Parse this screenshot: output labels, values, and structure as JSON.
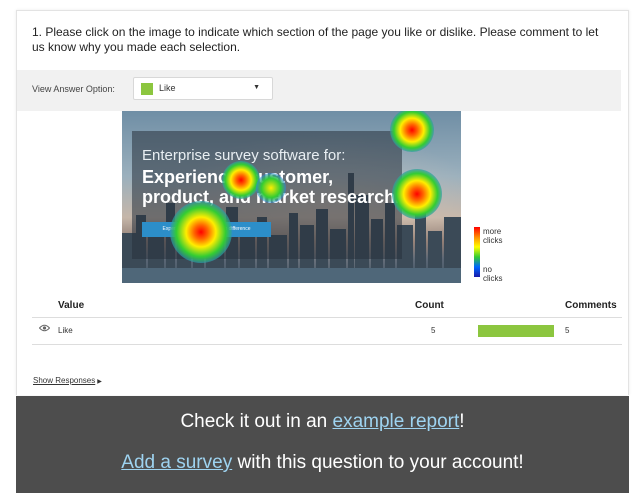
{
  "question": {
    "text": "1. Please click on the image to indicate which section of the page you like or dislike. Please comment to let us know why you made each selection."
  },
  "answer_option": {
    "label": "View Answer Option:",
    "selected": "Like",
    "swatch_color": "#8cc63f"
  },
  "heatmap": {
    "headline_small": "Enterprise survey software for:",
    "headline_big_1": "Experience, customer,",
    "headline_big_2": "product, and market research.",
    "button_text": "Experience the SurveyGizmo difference",
    "legend_more": "more clicks",
    "legend_no": "no clicks",
    "click_count": 5,
    "click_spots": 5
  },
  "table": {
    "headers": {
      "value": "Value",
      "count": "Count",
      "comments": "Comments"
    },
    "rows": [
      {
        "value": "Like",
        "count": "5",
        "comments": "5",
        "bar_fraction": 1.0,
        "bar_color": "#8cc63f"
      }
    ]
  },
  "show_responses": "Show Responses",
  "footer": {
    "line1_prefix": "Check it out in an ",
    "line1_link": "example report",
    "line1_suffix": "!",
    "line2_link": "Add a survey",
    "line2_suffix": " with this question to your account!",
    "background": "#4d4d4d",
    "link_color": "#9ed3f0"
  }
}
